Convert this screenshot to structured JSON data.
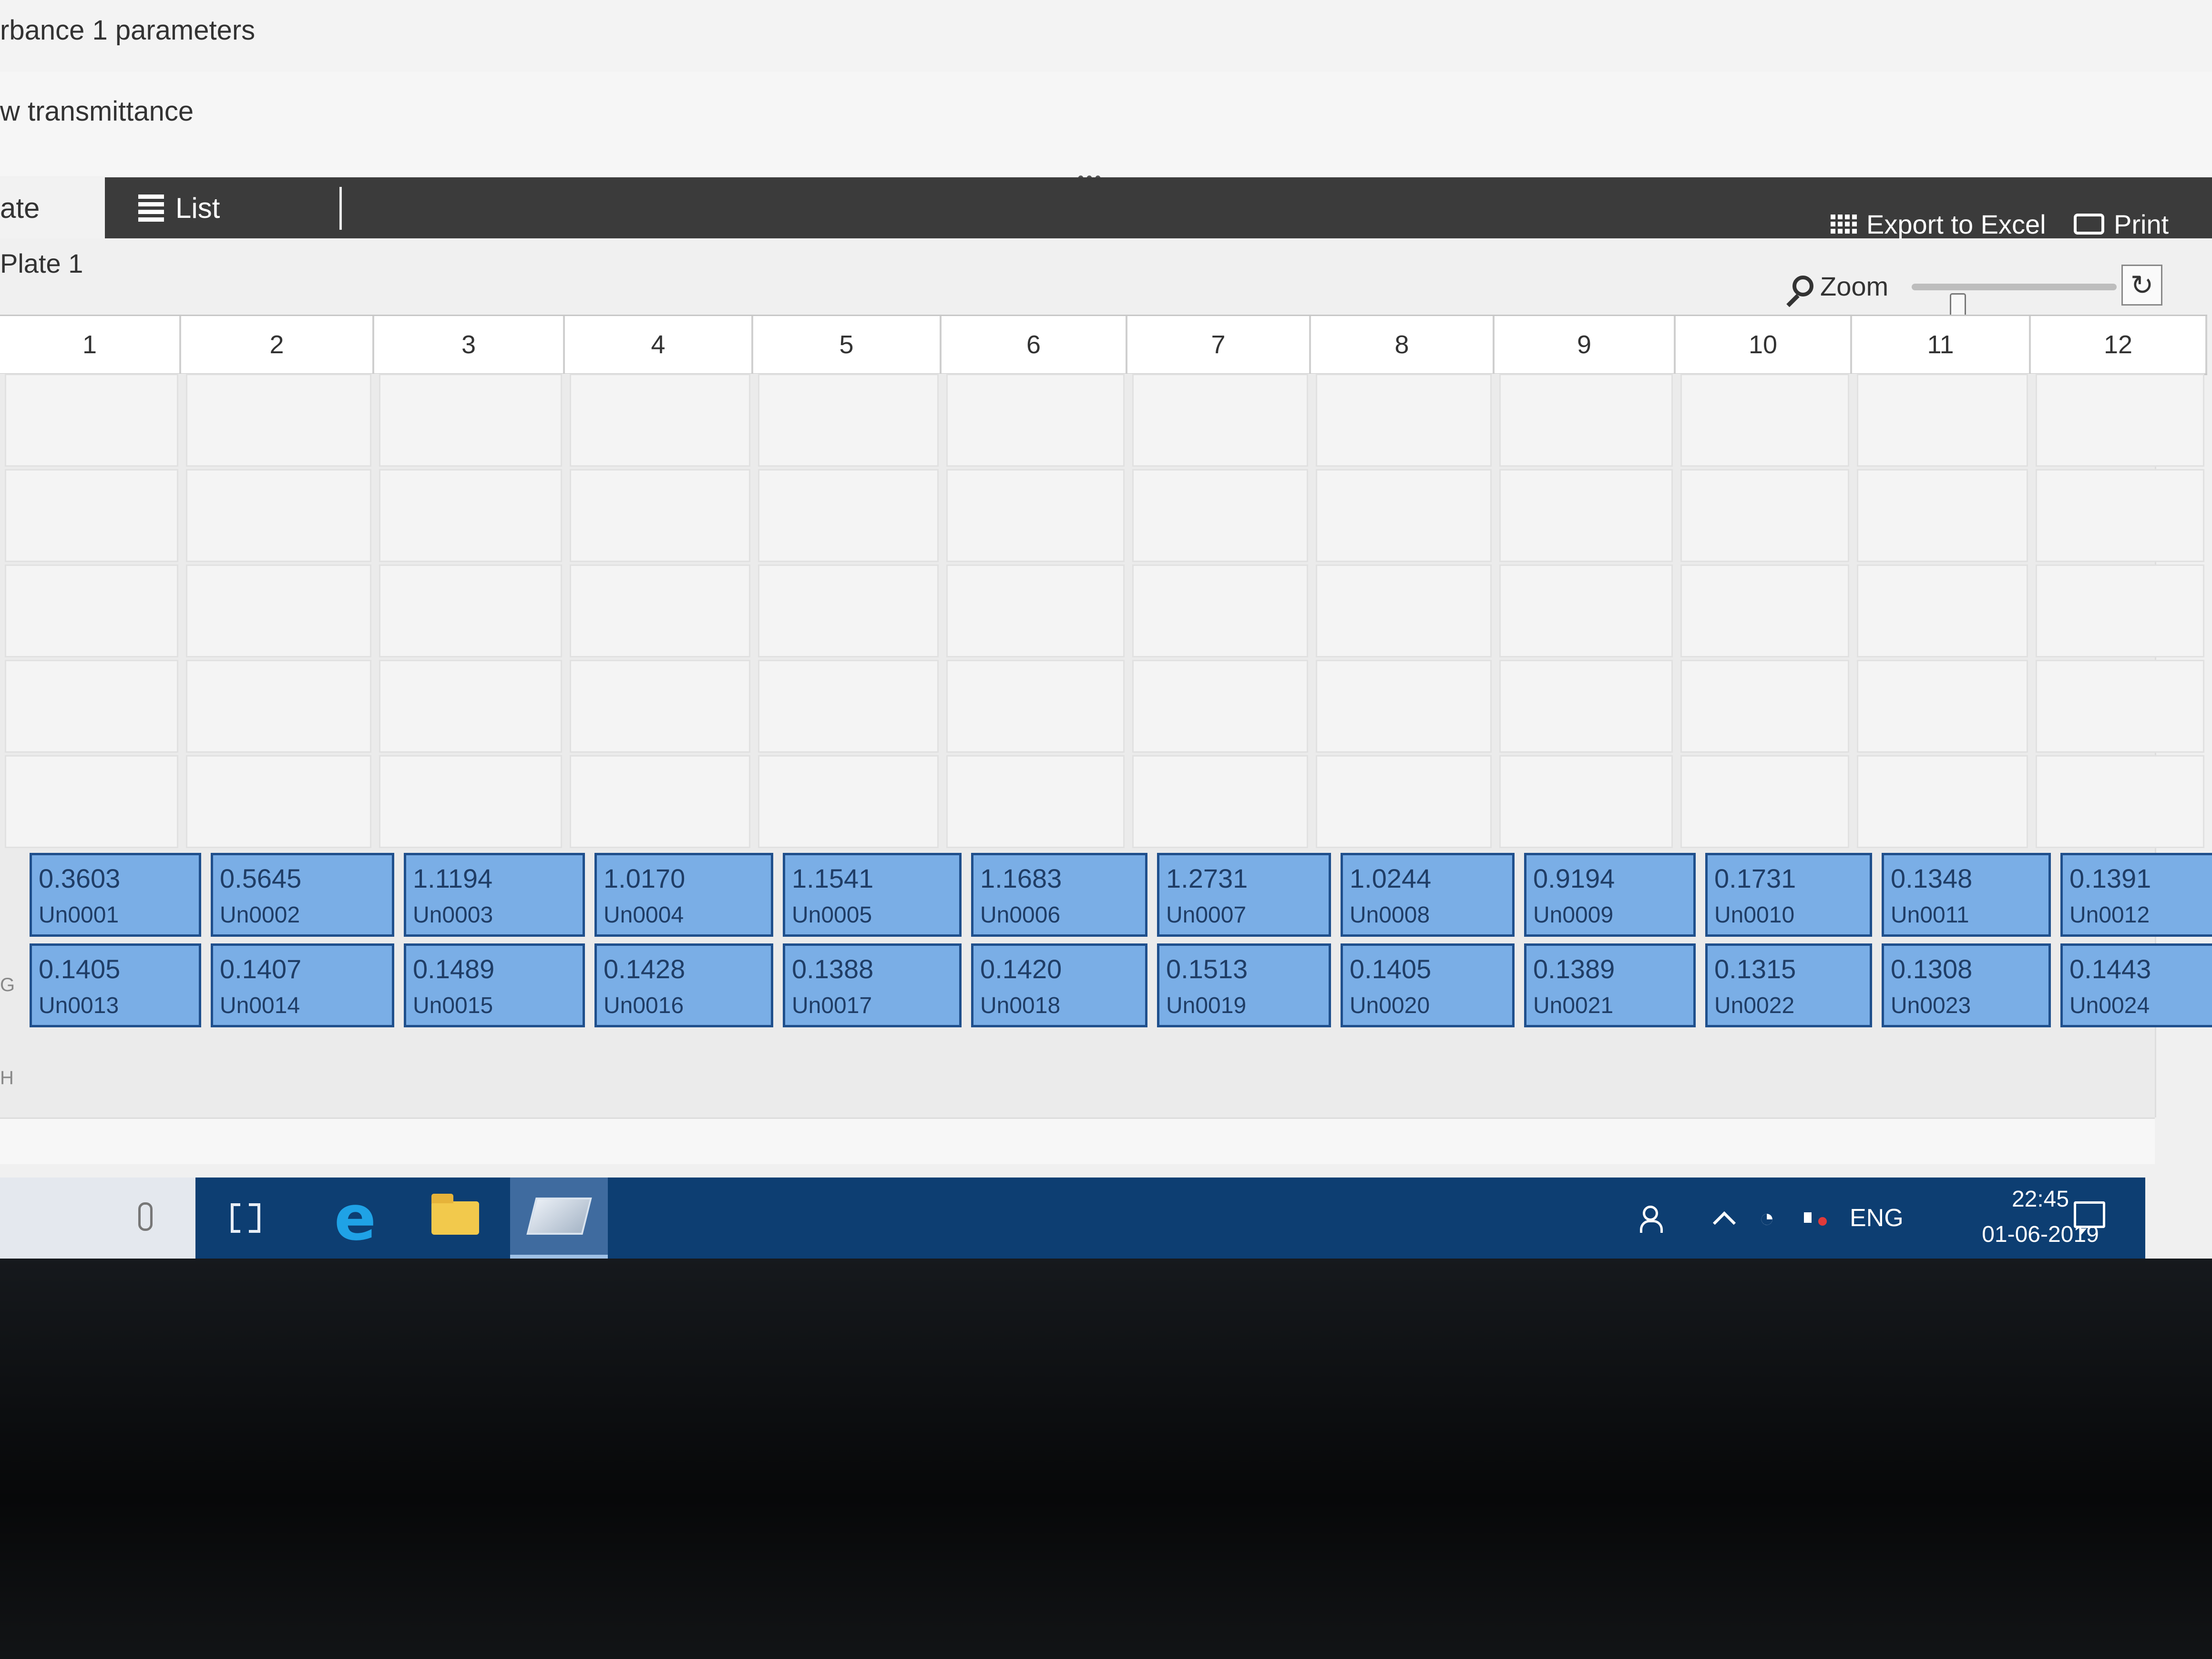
{
  "window": {
    "param_title": "rbance 1 parameters",
    "param_subtitle": "w transmittance"
  },
  "tabs": {
    "plate_label": "ate",
    "list_label": "List"
  },
  "toolbar": {
    "export_label": "Export to Excel",
    "print_label": "Print",
    "zoom_label": "Zoom",
    "zoom_level": 0.2
  },
  "plate": {
    "name": "Plate 1",
    "columns": [
      "1",
      "2",
      "3",
      "4",
      "5",
      "6",
      "7",
      "8",
      "9",
      "10",
      "11",
      "12"
    ],
    "row_g_letter": "G",
    "row_h_letter": "H",
    "row_g": [
      {
        "value": "0.3603",
        "id": "Un0001"
      },
      {
        "value": "0.5645",
        "id": "Un0002"
      },
      {
        "value": "1.1194",
        "id": "Un0003"
      },
      {
        "value": "1.0170",
        "id": "Un0004"
      },
      {
        "value": "1.1541",
        "id": "Un0005"
      },
      {
        "value": "1.1683",
        "id": "Un0006"
      },
      {
        "value": "1.2731",
        "id": "Un0007"
      },
      {
        "value": "1.0244",
        "id": "Un0008"
      },
      {
        "value": "0.9194",
        "id": "Un0009"
      },
      {
        "value": "0.1731",
        "id": "Un0010"
      },
      {
        "value": "0.1348",
        "id": "Un0011"
      },
      {
        "value": "0.1391",
        "id": "Un0012"
      }
    ],
    "row_h": [
      {
        "value": "0.1405",
        "id": "Un0013"
      },
      {
        "value": "0.1407",
        "id": "Un0014"
      },
      {
        "value": "0.1489",
        "id": "Un0015"
      },
      {
        "value": "0.1428",
        "id": "Un0016"
      },
      {
        "value": "0.1388",
        "id": "Un0017"
      },
      {
        "value": "0.1420",
        "id": "Un0018"
      },
      {
        "value": "0.1513",
        "id": "Un0019"
      },
      {
        "value": "0.1405",
        "id": "Un0020"
      },
      {
        "value": "0.1389",
        "id": "Un0021"
      },
      {
        "value": "0.1315",
        "id": "Un0022"
      },
      {
        "value": "0.1308",
        "id": "Un0023"
      },
      {
        "value": "0.1443",
        "id": "Un0024"
      }
    ]
  },
  "taskbar": {
    "language": "ENG",
    "time": "22:45",
    "date": "01-06-2019",
    "icons": [
      "microphone-icon",
      "task-view-icon",
      "edge-browser-icon",
      "file-explorer-icon",
      "plate-reader-app-icon",
      "people-icon",
      "chevron-up-icon",
      "wifi-icon",
      "speaker-muted-icon",
      "notification-icon"
    ]
  },
  "colors": {
    "well_fill": "#7aaee6",
    "well_border": "#1f4f8c",
    "taskbar": "#0d3e72",
    "tabbar": "#3b3b3b"
  }
}
